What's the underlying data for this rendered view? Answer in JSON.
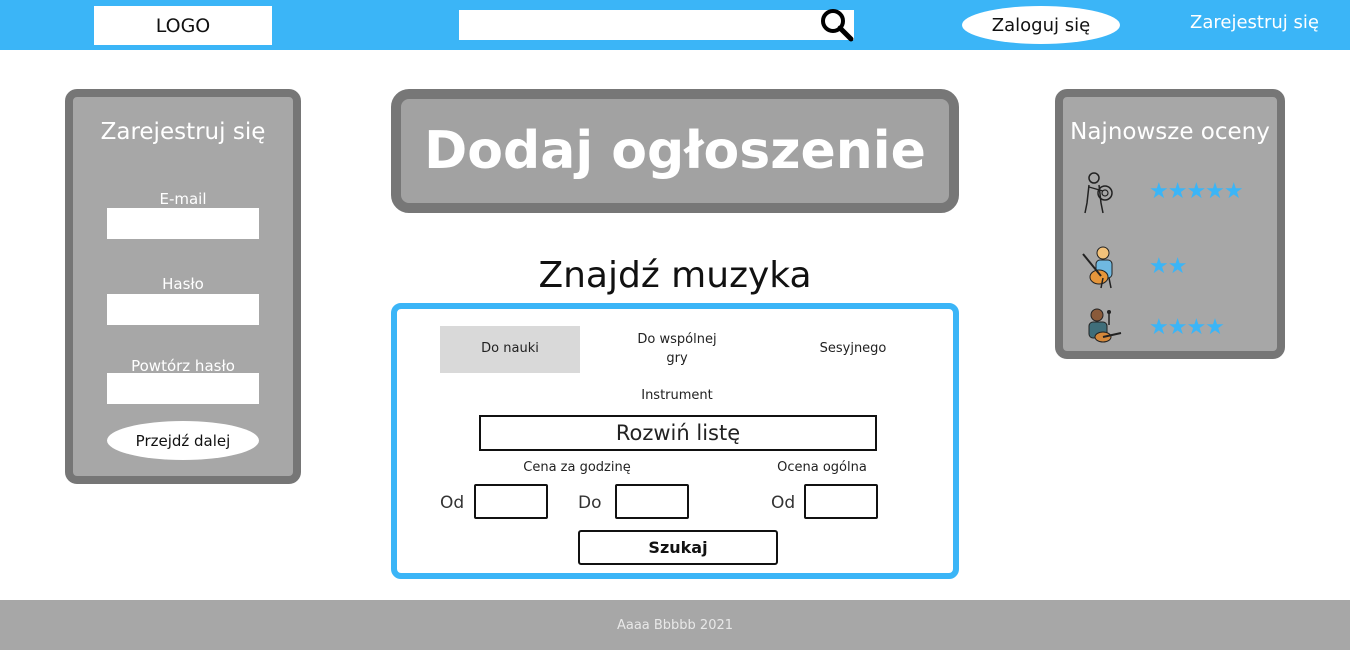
{
  "header": {
    "logo": "LOGO",
    "search_placeholder": "",
    "login_label": "Zaloguj się",
    "register_label": "Zarejestruj się"
  },
  "register_panel": {
    "title": "Zarejestruj się",
    "email_label": "E-mail",
    "password_label": "Hasło",
    "repeat_password_label": "Powtórz hasło",
    "next_button": "Przejdź dalej"
  },
  "add_ad": {
    "label": "Dodaj ogłoszenie"
  },
  "find": {
    "title": "Znajdź muzyka",
    "tabs": [
      {
        "label": "Do nauki",
        "active": true
      },
      {
        "label": "Do wspólnej gry",
        "active": false
      },
      {
        "label": "Sesyjnego",
        "active": false
      }
    ],
    "instrument_label": "Instrument",
    "instrument_dropdown": "Rozwiń listę",
    "price_label": "Cena za godzinę",
    "price_from_label": "Od",
    "price_to_label": "Do",
    "rating_label": "Ocena ogólna",
    "rating_from_label": "Od",
    "search_button": "Szukaj"
  },
  "ratings_panel": {
    "title": "Najnowsze oceny",
    "entries": [
      {
        "avatar": "horn-player-icon",
        "stars": 5,
        "stars_text": "★★★★★"
      },
      {
        "avatar": "guitarist-icon",
        "stars": 2,
        "stars_text": "★★"
      },
      {
        "avatar": "singer-guitarist-icon",
        "stars": 4,
        "stars_text": "★★★★"
      }
    ],
    "star_color": "#3bb5f7"
  },
  "footer": {
    "text": "Aaaa Bbbbb 2021"
  },
  "colors": {
    "accent": "#3bb5f7",
    "panel_gray": "#a7a7a7",
    "panel_border": "#767676"
  }
}
